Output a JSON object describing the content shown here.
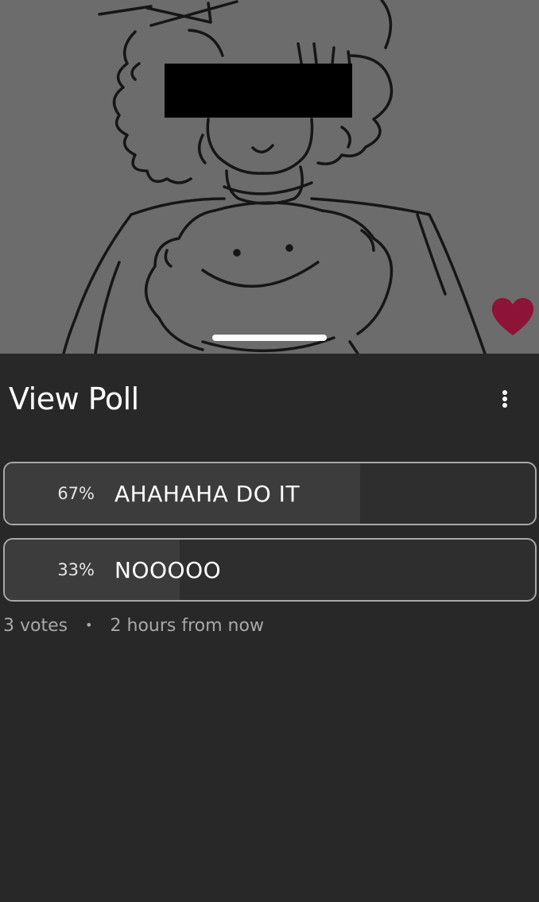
{
  "sheet": {
    "title": "View Poll",
    "menu_icon": "more-vertical-icon"
  },
  "artwork": {
    "overlay_color": "#6c6c6c",
    "favorite_icon": "heart-icon",
    "favorite_color": "#8e1338"
  },
  "poll": {
    "options": [
      {
        "percent_label": "67%",
        "label": "AHAHAHA DO IT",
        "share": 0.67
      },
      {
        "percent_label": "33%",
        "label": "NOOOOO",
        "share": 0.33
      }
    ],
    "votes": "3 votes",
    "separator": "•",
    "closes": "2 hours from now"
  },
  "colors": {
    "background": "#282828",
    "option_border": "#a8a8a8",
    "result_fill": "#3c3c3c",
    "meta_text": "#a9a9a9"
  }
}
